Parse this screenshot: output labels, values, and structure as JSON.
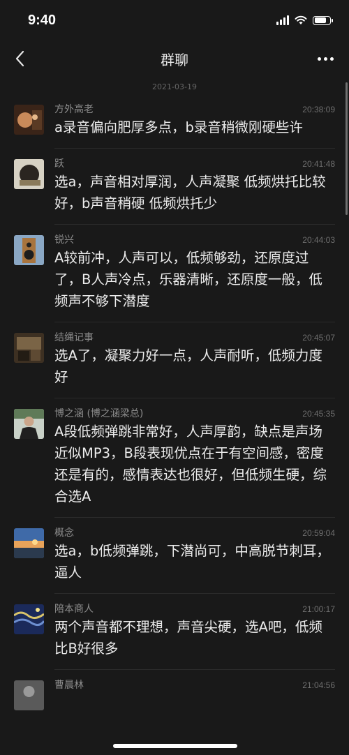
{
  "status": {
    "time": "9:40"
  },
  "header": {
    "title": "群聊"
  },
  "date": "2021-03-19",
  "messages": [
    {
      "name": "方外高老",
      "time": "20:38:09",
      "text": "a录音偏向肥厚多点，b录音稍微刚硬些许",
      "avatar": "avatar-warm"
    },
    {
      "name": "跃",
      "time": "20:41:48",
      "text": "选a，声音相对厚润，人声凝聚 低频烘托比较好，b声音稍硬 低频烘托少",
      "avatar": "avatar-figure"
    },
    {
      "name": "锐兴",
      "time": "20:44:03",
      "text": "A较前冲，人声可以，低频够劲，还原度过了，B人声冷点，乐器清晰，还原度一般，低频声不够下潜度",
      "avatar": "avatar-speaker"
    },
    {
      "name": "结绳记事",
      "time": "20:45:07",
      "text": "选A了，凝聚力好一点，人声耐听，低频力度好",
      "avatar": "avatar-room"
    },
    {
      "name": "博之涵 (博之涵梁总)",
      "time": "20:45:35",
      "text": "A段低频弹跳非常好，人声厚韵，缺点是声场近似MP3，B段表现优点在于有空间感，密度还是有的，感情表达也很好，但低频生硬，综合选A",
      "avatar": "avatar-person"
    },
    {
      "name": "概念",
      "time": "20:59:04",
      "text": "选a，b低频弹跳，下潜尚可，中高脱节刺耳，逼人",
      "avatar": "avatar-sunset"
    },
    {
      "name": "陪本商人",
      "time": "21:00:17",
      "text": "两个声音都不理想，声音尖硬，选A吧，低频比B好很多",
      "avatar": "avatar-night"
    },
    {
      "name": "曹晨林",
      "time": "21:04:56",
      "text": "",
      "avatar": "avatar-gray"
    }
  ]
}
